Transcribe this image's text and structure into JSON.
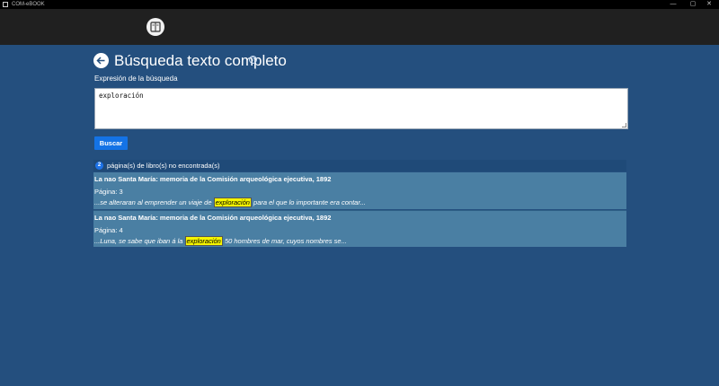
{
  "window": {
    "title": "COM-eBOOK",
    "controls": {
      "minimize": "—",
      "maximize": "▢",
      "close": "✕"
    }
  },
  "page": {
    "title": "Búsqueda texto completo",
    "help": "?"
  },
  "search": {
    "label": "Expresión de la búsqueda",
    "value": "exploración",
    "button": "Buscar"
  },
  "results": {
    "count": "2",
    "summary": "página(s) de libro(s) no encontrada(s)",
    "items": [
      {
        "title": "La nao Santa María: memoria de la Comisión arqueológica ejecutiva, 1892",
        "page": "Página: 3",
        "before": "...se alteraran al emprender un viaje de ",
        "highlight": "exploración",
        "after": " para el que lo importante era contar..."
      },
      {
        "title": "La nao Santa María: memoria de la Comisión arqueológica ejecutiva, 1892",
        "page": "Página: 4",
        "before": "...Luna, se sabe que iban á la ",
        "highlight": "exploración",
        "after": " 50 hombres de mar, cuyos nombres se..."
      }
    ]
  },
  "colors": {
    "background": "#244f7e",
    "topbar": "#202020",
    "button": "#1473e6",
    "result_row": "#4a7fa3",
    "highlight": "#f5f500"
  }
}
